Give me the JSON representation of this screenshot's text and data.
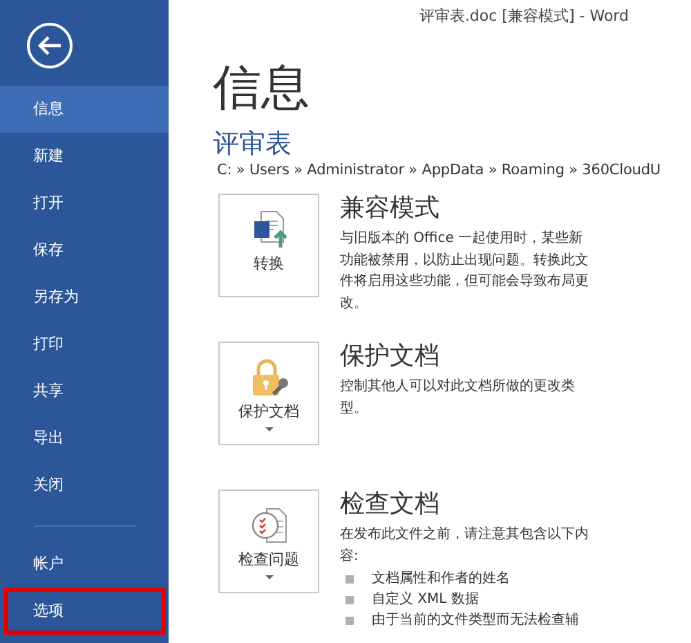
{
  "window": {
    "title": "评审表.doc [兼容模式] - Word"
  },
  "sidebar": {
    "items": [
      {
        "label": "信息",
        "selected": true,
        "highlighted": false
      },
      {
        "label": "新建",
        "selected": false,
        "highlighted": false
      },
      {
        "label": "打开",
        "selected": false,
        "highlighted": false
      },
      {
        "label": "保存",
        "selected": false,
        "highlighted": false
      },
      {
        "label": "另存为",
        "selected": false,
        "highlighted": false
      },
      {
        "label": "打印",
        "selected": false,
        "highlighted": false
      },
      {
        "label": "共享",
        "selected": false,
        "highlighted": false
      },
      {
        "label": "导出",
        "selected": false,
        "highlighted": false
      },
      {
        "label": "关闭",
        "selected": false,
        "highlighted": false
      }
    ],
    "bottom_items": [
      {
        "label": "帐户",
        "selected": false,
        "highlighted": false
      },
      {
        "label": "选项",
        "selected": false,
        "highlighted": true
      }
    ]
  },
  "page": {
    "heading": "信息",
    "document_name": "评审表",
    "path": "C: » Users » Administrator » AppData » Roaming » 360CloudU"
  },
  "sections": [
    {
      "kind": "convert",
      "button": "转换",
      "dropdown": false,
      "title": "兼容模式",
      "description": "与旧版本的 Office 一起使用时，某些新功能被禁用，以防止出现问题。转换此文件将启用这些功能，但可能会导致布局更改。"
    },
    {
      "kind": "protect",
      "button": "保护文档",
      "dropdown": true,
      "title": "保护文档",
      "description": "控制其他人可以对此文档所做的更改类型。"
    },
    {
      "kind": "inspect",
      "button": "检查问题",
      "dropdown": true,
      "title": "检查文档",
      "description": "在发布此文件之前，请注意其包含以下内容:",
      "bullets": [
        "文档属性和作者的姓名",
        "自定义 XML 数据",
        "由于当前的文件类型而无法检查辅"
      ]
    }
  ]
}
